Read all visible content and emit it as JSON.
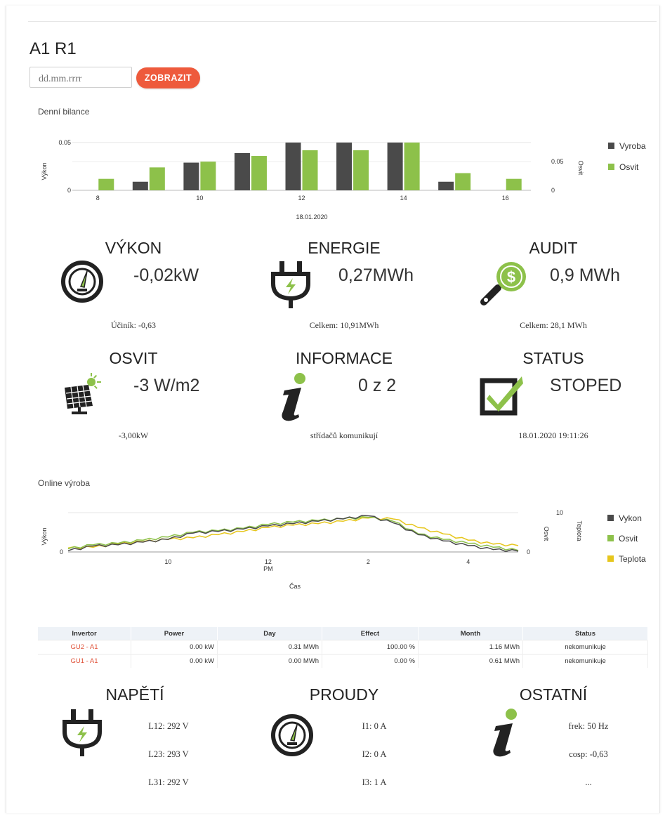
{
  "page": {
    "title": "A1 R1"
  },
  "date_filter": {
    "placeholder": "dd.mm.rrrr",
    "button_label": "ZOBRAZIT"
  },
  "colors": {
    "accent": "#ee5a3c",
    "series_dark": "#4a4a4a",
    "series_green": "#8dc14a",
    "series_yellow": "#e6c61c",
    "link": "#e0533a"
  },
  "daily_chart": {
    "title": "Denní bilance",
    "date_label": "18.01.2020",
    "left_axis_label": "Výkon",
    "right_axis_label": "Osvit"
  },
  "online_chart": {
    "title": "Online výroba",
    "left_axis_label": "Výkon",
    "right_axis_label_1": "Osvit",
    "right_axis_label_2": "Teplota",
    "x_axis_label": "Čas"
  },
  "chart_data": [
    {
      "type": "bar",
      "title": "Denní bilance",
      "xlabel": "18.01.2020",
      "ylabel": "Výkon",
      "y2label": "Osvit",
      "x_ticks": [
        8,
        10,
        12,
        14,
        16
      ],
      "y_ticks": [
        "0",
        "0.05"
      ],
      "y2_ticks": [
        "0",
        "0.05"
      ],
      "legend_position": "right",
      "categories": [
        8,
        9,
        10,
        11,
        12,
        13,
        14,
        15,
        16
      ],
      "series": [
        {
          "name": "Vyroba",
          "color": "#4a4a4a",
          "values": [
            0,
            0.009,
            0.029,
            0.039,
            0.05,
            0.05,
            0.05,
            0.009,
            0
          ]
        },
        {
          "name": "Osvit",
          "color": "#8dc14a",
          "values": [
            0.012,
            0.024,
            0.03,
            0.036,
            0.042,
            0.042,
            0.05,
            0.018,
            0.012
          ]
        }
      ],
      "ylim": [
        0,
        0.05
      ]
    },
    {
      "type": "line",
      "title": "Online výroba",
      "xlabel": "Čas",
      "ylabel": "Výkon",
      "y2label": "Osvit",
      "y3label": "Teplota",
      "x_ticks": [
        "10",
        "12",
        "2",
        "4"
      ],
      "x_tick_sub": [
        "",
        "PM",
        "",
        ""
      ],
      "y_ticks": [
        "0"
      ],
      "y2_ticks": [
        "0",
        "10"
      ],
      "legend_position": "right",
      "x_hours": [
        8.0,
        8.5,
        9.0,
        9.5,
        10.0,
        10.5,
        11.0,
        11.5,
        12.0,
        12.5,
        13.0,
        13.5,
        14.0,
        14.5,
        15.0,
        15.5,
        16.0,
        16.5,
        17.0
      ],
      "series": [
        {
          "name": "Vykon",
          "color": "#4a4a4a",
          "values": [
            0.3,
            1.5,
            1.8,
            2.5,
            3.2,
            4.8,
            5.2,
            5.8,
            6.6,
            7.2,
            7.8,
            8.4,
            9.2,
            7.4,
            4.4,
            2.8,
            1.6,
            0.6,
            0.2
          ]
        },
        {
          "name": "Osvit",
          "color": "#8dc14a",
          "values": [
            0.8,
            1.8,
            2.2,
            3.0,
            3.8,
            5.0,
            5.4,
            6.0,
            7.0,
            7.6,
            8.0,
            8.4,
            8.8,
            7.8,
            4.6,
            3.2,
            2.2,
            1.2,
            0.4
          ]
        },
        {
          "name": "Teplota",
          "color": "#e6c61c",
          "values": [
            1.0,
            1.2,
            2.0,
            2.6,
            3.2,
            3.6,
            4.4,
            5.2,
            6.2,
            6.8,
            7.2,
            7.8,
            8.6,
            8.4,
            6.2,
            4.6,
            3.0,
            2.0,
            1.6
          ]
        }
      ],
      "ylim": [
        0,
        10
      ]
    }
  ],
  "cards": [
    {
      "title": "VÝKON",
      "value": "-0,02kW",
      "sub": "Účiník: -0,63",
      "icon": "gauge-icon"
    },
    {
      "title": "ENERGIE",
      "value": "0,27MWh",
      "sub": "Celkem: 10,91MWh",
      "icon": "plug-icon"
    },
    {
      "title": "AUDIT",
      "value": "0,9 MWh",
      "sub": "Celkem: 28,1 MWh",
      "icon": "dollar-magnifier-icon"
    },
    {
      "title": "OSVIT",
      "value": "-3 W/m2",
      "sub": "-3,00kW",
      "icon": "solar-panel-icon"
    },
    {
      "title": "INFORMACE",
      "value": "0 z 2",
      "sub": "střídačů komunikují",
      "icon": "info-icon"
    },
    {
      "title": "STATUS",
      "value": "STOPED",
      "sub": "18.01.2020 19:11:26",
      "icon": "checkbox-icon"
    }
  ],
  "table": {
    "headers": [
      "Invertor",
      "Power",
      "Day",
      "Effect",
      "Month",
      "Status"
    ],
    "rows": [
      [
        "GU2 - A1",
        "0.00 kW",
        "0.31 MWh",
        "100.00 %",
        "1.16 MWh",
        "nekomunikuje"
      ],
      [
        "GU1 - A1",
        "0.00 kW",
        "0.00 MWh",
        "0.00 %",
        "0.61 MWh",
        "nekomunikuje"
      ]
    ]
  },
  "bottom": [
    {
      "title": "NAPĚTÍ",
      "icon": "plug-icon",
      "lines": [
        "L12: 292 V",
        "L23: 293 V",
        "L31: 292 V"
      ]
    },
    {
      "title": "PROUDY",
      "icon": "gauge-icon",
      "lines": [
        "I1: 0 A",
        "I2: 0 A",
        "I3: 1 A"
      ]
    },
    {
      "title": "OSTATNÍ",
      "icon": "info-icon",
      "lines": [
        "frek: 50 Hz",
        "cosp: -0,63",
        "..."
      ]
    }
  ]
}
